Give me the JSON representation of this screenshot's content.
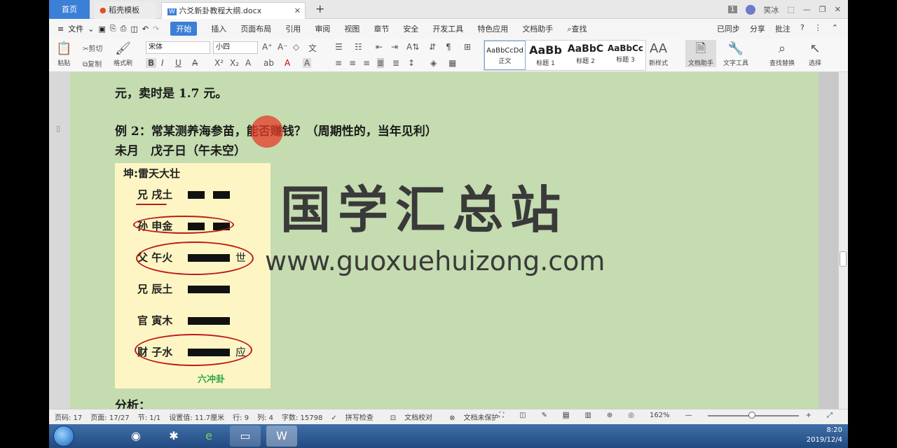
{
  "tabs": {
    "home": "首页",
    "template": "稻壳模板",
    "document": "六爻新卦教程大纲.docx",
    "page_badge": "1",
    "user": "笑冰"
  },
  "menu": {
    "file": "文件",
    "items": [
      "开始",
      "插入",
      "页面布局",
      "引用",
      "审阅",
      "视图",
      "章节",
      "安全",
      "开发工具",
      "特色应用",
      "文档助手"
    ],
    "search": "查找",
    "right": [
      "已同步",
      "分享",
      "批注",
      "?"
    ]
  },
  "ribbon": {
    "paste": "粘贴",
    "cut": "剪切",
    "copy": "复制",
    "format_painter": "格式刷",
    "font_name": "宋体",
    "font_size": "小四",
    "styles": [
      {
        "preview": "AaBbCcDd",
        "label": "正文"
      },
      {
        "preview": "AaBb",
        "label": "标题 1"
      },
      {
        "preview": "AaBbC",
        "label": "标题 2"
      },
      {
        "preview": "AaBbCc",
        "label": "标题 3"
      }
    ],
    "new_style": "新样式",
    "doc_helper": "文档助手",
    "text_tools": "文字工具",
    "find_replace": "查找替换",
    "select": "选择"
  },
  "document": {
    "line1": "元，卖时是 1.7 元。",
    "line2": "例 2：常某测养海参苗，能否赚钱？（周期性的，当年见利）",
    "line3": "未月　戊子日（午未空）",
    "line4": "分析：",
    "figure": {
      "title": "坤:雷天大壮",
      "yaos": [
        {
          "label": "兄 戌土",
          "type": "yin",
          "mark": ""
        },
        {
          "label": "孙 申金",
          "type": "yin",
          "mark": ""
        },
        {
          "label": "父 午火",
          "type": "yang",
          "mark": "世"
        },
        {
          "label": "兄 辰土",
          "type": "yang",
          "mark": ""
        },
        {
          "label": "官 寅木",
          "type": "yang",
          "mark": ""
        },
        {
          "label": "财 子水",
          "type": "yang",
          "mark": "应"
        }
      ],
      "footer": "六冲卦"
    },
    "watermark_cn": "国学汇总站",
    "watermark_url": "www.guoxuehuizong.com"
  },
  "status": {
    "page_code": "页码: 17",
    "pages": "页面: 17/27",
    "section": "节: 1/1",
    "setting": "设置值: 11.7厘米",
    "row": "行: 9",
    "col": "列: 4",
    "chars": "字数: 15798",
    "spell": "拼写检查",
    "proof": "文档校对",
    "protect": "文档未保护",
    "zoom": "162%"
  },
  "taskbar": {
    "time": "8:20",
    "date": "2019/12/4"
  }
}
